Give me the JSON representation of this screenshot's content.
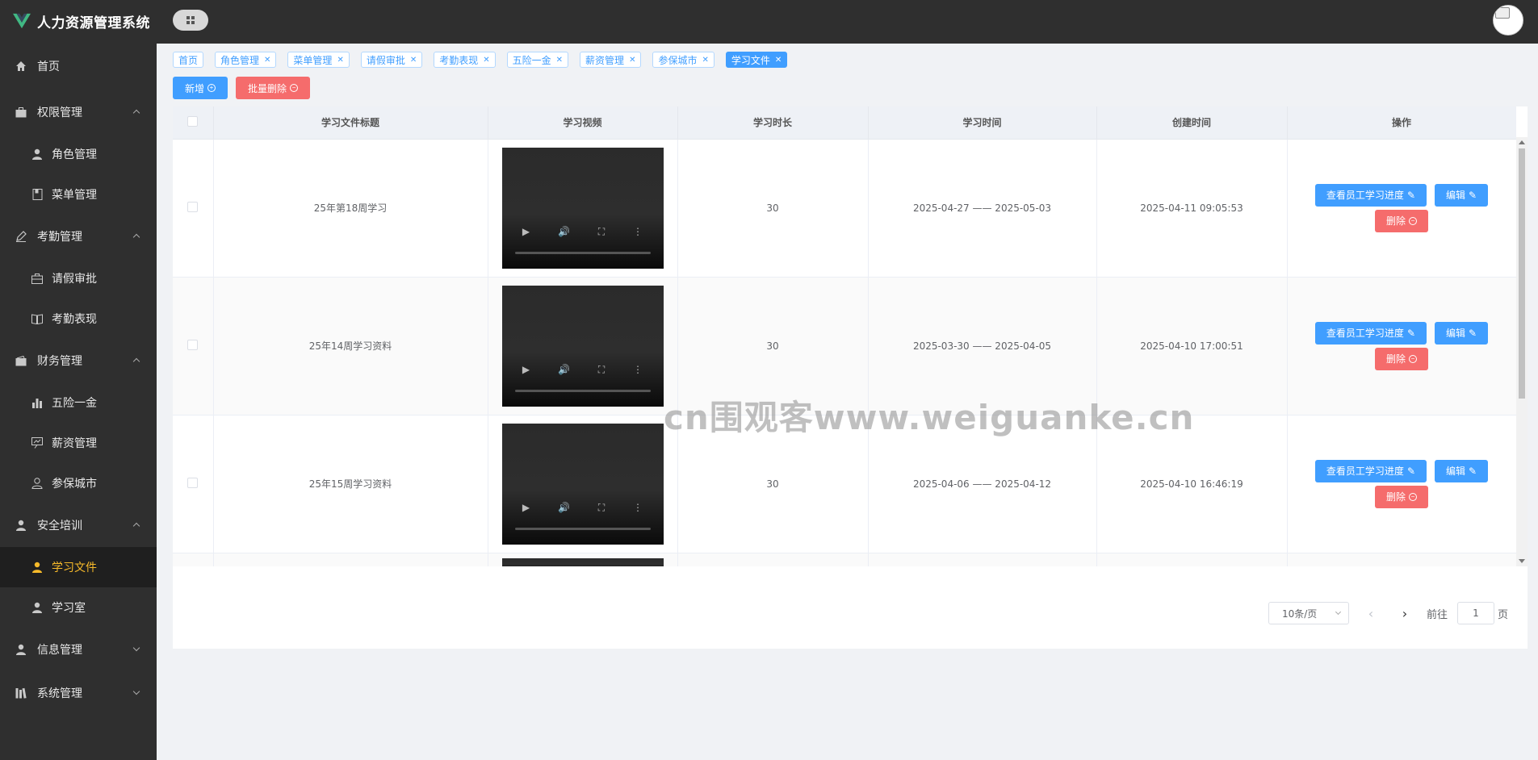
{
  "app": {
    "title": "人力资源管理系统"
  },
  "sidebar": {
    "home": "首页",
    "groups": [
      {
        "label": "权限管理",
        "expanded": true,
        "items": [
          {
            "label": "角色管理",
            "icon": "user-icon"
          },
          {
            "label": "菜单管理",
            "icon": "menu-book-icon"
          }
        ]
      },
      {
        "label": "考勤管理",
        "expanded": true,
        "items": [
          {
            "label": "请假审批",
            "icon": "briefcase-icon"
          },
          {
            "label": "考勤表现",
            "icon": "book-icon"
          }
        ]
      },
      {
        "label": "财务管理",
        "expanded": true,
        "items": [
          {
            "label": "五险一金",
            "icon": "bar-chart-icon"
          },
          {
            "label": "薪资管理",
            "icon": "presentation-icon"
          },
          {
            "label": "参保城市",
            "icon": "user-outline-icon"
          }
        ]
      },
      {
        "label": "安全培训",
        "expanded": true,
        "items": [
          {
            "label": "学习文件",
            "icon": "user-icon",
            "active": true
          },
          {
            "label": "学习室",
            "icon": "user-icon"
          }
        ]
      },
      {
        "label": "信息管理",
        "expanded": false,
        "items": []
      },
      {
        "label": "系统管理",
        "expanded": false,
        "items": []
      }
    ]
  },
  "tags": [
    {
      "label": "首页",
      "closable": false
    },
    {
      "label": "角色管理",
      "closable": true
    },
    {
      "label": "菜单管理",
      "closable": true
    },
    {
      "label": "请假审批",
      "closable": true
    },
    {
      "label": "考勤表现",
      "closable": true
    },
    {
      "label": "五险一金",
      "closable": true
    },
    {
      "label": "薪资管理",
      "closable": true
    },
    {
      "label": "参保城市",
      "closable": true
    },
    {
      "label": "学习文件",
      "closable": true,
      "active": true
    }
  ],
  "toolbar": {
    "add_label": "新增",
    "batch_delete_label": "批量删除"
  },
  "table": {
    "columns": [
      "学习文件标题",
      "学习视频",
      "学习时长",
      "学习时间",
      "创建时间",
      "操作"
    ],
    "rows": [
      {
        "title": "25年第18周学习",
        "duration": "30",
        "period": "2025-04-27 —— 2025-05-03",
        "created": "2025-04-11 09:05:53"
      },
      {
        "title": "25年14周学习资料",
        "duration": "30",
        "period": "2025-03-30 —— 2025-04-05",
        "created": "2025-04-10 17:00:51"
      },
      {
        "title": "25年15周学习资料",
        "duration": "30",
        "period": "2025-04-06 —— 2025-04-12",
        "created": "2025-04-10 16:46:19"
      }
    ],
    "actions": {
      "view_progress": "查看员工学习进度",
      "edit": "编辑",
      "delete": "删除"
    }
  },
  "pagination": {
    "page_size": "10条/页",
    "goto_label": "前往",
    "page": "1",
    "page_suffix": "页"
  },
  "watermark": "cn围观客www.weiguanke.cn",
  "colors": {
    "primary": "#409eff",
    "danger": "#f56c6c",
    "sidebar_bg": "#2f2f2f",
    "active_menu": "#f7ba2a"
  }
}
